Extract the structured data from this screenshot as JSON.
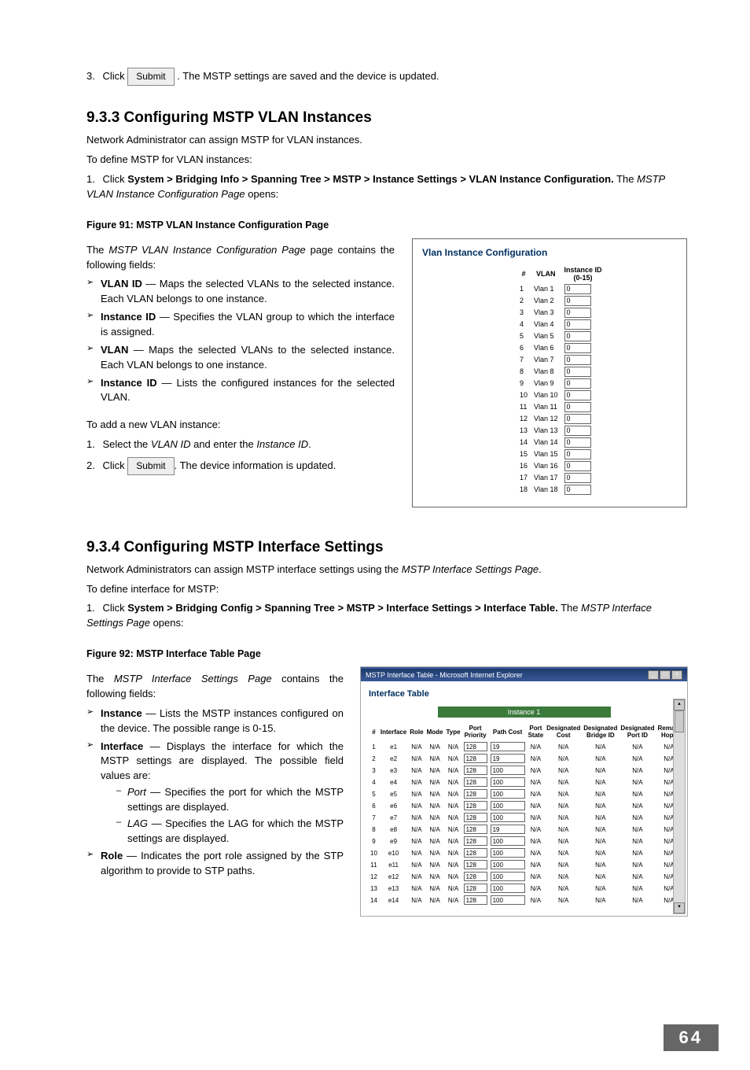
{
  "step3": {
    "num": "3.",
    "pre": "Click ",
    "btn": "Submit",
    "post": ". The MSTP settings are saved and the device is updated."
  },
  "sec933": {
    "heading": "9.3.3   Configuring MSTP VLAN Instances",
    "intro": "Network Administrator can assign MSTP for VLAN instances.",
    "lead": "To define MSTP for VLAN instances:",
    "s1": {
      "num": "1.",
      "pre": "Click ",
      "path": "System > Bridging Info > Spanning Tree > MSTP > Instance Settings > VLAN Instance Configuration.",
      "post": " The ",
      "italic": "MSTP VLAN Instance Configuration Page",
      "tail": " opens:"
    },
    "fig": "Figure 91: MSTP VLAN Instance Configuration Page",
    "desc1": "The ",
    "desc1i": "MSTP VLAN Instance Configuration Page",
    "desc1t": " page contains the following fields:",
    "bullets": [
      {
        "b": "VLAN ID",
        "t": " — Maps the selected VLANs to the selected instance. Each VLAN belongs to one instance."
      },
      {
        "b": "Instance ID",
        "t": " — Specifies the VLAN group to which the interface is assigned."
      },
      {
        "b": "VLAN",
        "t": " — Maps the selected VLANs to the selected instance. Each VLAN belongs to one instance."
      },
      {
        "b": "Instance ID",
        "t": " — Lists the configured instances for the selected VLAN."
      }
    ],
    "addLead": "To add a new VLAN instance:",
    "add1": {
      "num": "1.",
      "pre": "Select the ",
      "i1": "VLAN ID",
      "mid": " and enter the ",
      "i2": "Instance ID",
      "post": "."
    },
    "add2": {
      "num": "2.",
      "pre": "Click ",
      "btn": "Submit",
      "post": ". The device information is updated."
    }
  },
  "vlanPanel": {
    "title": "Vlan Instance Configuration",
    "h_num": "#",
    "h_vlan": "VLAN",
    "h_inst": "Instance ID\n(0-15)"
  },
  "chart_data": {
    "type": "table",
    "title": "Vlan Instance Configuration",
    "columns": [
      "#",
      "VLAN",
      "Instance ID (0-15)"
    ],
    "rows": [
      [
        1,
        "Vlan 1",
        "0"
      ],
      [
        2,
        "Vlan 2",
        "0"
      ],
      [
        3,
        "Vlan 3",
        "0"
      ],
      [
        4,
        "Vlan 4",
        "0"
      ],
      [
        5,
        "Vlan 5",
        "0"
      ],
      [
        6,
        "Vlan 6",
        "0"
      ],
      [
        7,
        "Vlan 7",
        "0"
      ],
      [
        8,
        "Vlan 8",
        "0"
      ],
      [
        9,
        "Vlan 9",
        "0"
      ],
      [
        10,
        "Vlan 10",
        "0"
      ],
      [
        11,
        "Vlan 11",
        "0"
      ],
      [
        12,
        "Vlan 12",
        "0"
      ],
      [
        13,
        "Vlan 13",
        "0"
      ],
      [
        14,
        "Vlan 14",
        "0"
      ],
      [
        15,
        "Vlan 15",
        "0"
      ],
      [
        16,
        "Vlan 16",
        "0"
      ],
      [
        17,
        "Vlan 17",
        "0"
      ],
      [
        18,
        "Vlan 18",
        "0"
      ]
    ]
  },
  "sec934": {
    "heading": "9.3.4   Configuring MSTP Interface Settings",
    "intro1": "Network Administrators can assign MSTP interface settings using the ",
    "intro1i": "MSTP Interface Settings Page",
    "intro1t": ".",
    "lead": "To define interface for MSTP:",
    "s1": {
      "num": "1.",
      "pre": "Click ",
      "path": "System > Bridging Config > Spanning Tree > MSTP > Interface Settings > Interface Table.",
      "post": " The ",
      "italic": "MSTP Interface Settings Page",
      "tail": " opens:"
    },
    "fig": "Figure 92: MSTP Interface Table Page",
    "desc1": "The ",
    "desc1i": "MSTP Interface Settings Page",
    "desc1t": " contains the following fields:",
    "bullets": [
      {
        "b": "Instance",
        "t": " — Lists the MSTP instances configured on the device. The possible range is 0-15."
      },
      {
        "b": "Interface",
        "t": " — Displays the interface for which the MSTP settings are displayed. The possible field values are:"
      },
      {
        "b": "Role",
        "t": " — Indicates the port role assigned by the STP algorithm to provide to STP paths."
      }
    ],
    "sub": [
      {
        "b": "Port",
        "t": " — Specifies the port for which the MSTP settings are displayed."
      },
      {
        "b": "LAG",
        "t": " — Specifies the LAG for which the MSTP settings are displayed."
      }
    ]
  },
  "ifPanel": {
    "winTitle": "MSTP Interface Table - Microsoft Internet Explorer",
    "title": "Interface Table",
    "instanceLabel": "Instance 1",
    "headers": [
      "#",
      "Interface",
      "Role",
      "Mode",
      "Type",
      "Port Priority",
      "Path Cost",
      "Port State",
      "Designated Cost",
      "Designated Bridge ID",
      "Designated Port ID",
      "Remain Hops"
    ],
    "rows": [
      {
        "n": 1,
        "if": "e1",
        "pp": "128",
        "pc": "19"
      },
      {
        "n": 2,
        "if": "e2",
        "pp": "128",
        "pc": "19"
      },
      {
        "n": 3,
        "if": "e3",
        "pp": "128",
        "pc": "100"
      },
      {
        "n": 4,
        "if": "e4",
        "pp": "128",
        "pc": "100"
      },
      {
        "n": 5,
        "if": "e5",
        "pp": "128",
        "pc": "100"
      },
      {
        "n": 6,
        "if": "e6",
        "pp": "128",
        "pc": "100"
      },
      {
        "n": 7,
        "if": "e7",
        "pp": "128",
        "pc": "100"
      },
      {
        "n": 8,
        "if": "e8",
        "pp": "128",
        "pc": "19"
      },
      {
        "n": 9,
        "if": "e9",
        "pp": "128",
        "pc": "100"
      },
      {
        "n": 10,
        "if": "e10",
        "pp": "128",
        "pc": "100"
      },
      {
        "n": 11,
        "if": "e11",
        "pp": "128",
        "pc": "100"
      },
      {
        "n": 12,
        "if": "e12",
        "pp": "128",
        "pc": "100"
      },
      {
        "n": 13,
        "if": "e13",
        "pp": "128",
        "pc": "100"
      },
      {
        "n": 14,
        "if": "e14",
        "pp": "128",
        "pc": "100"
      }
    ],
    "na": "N/A"
  },
  "pageNum": "64"
}
